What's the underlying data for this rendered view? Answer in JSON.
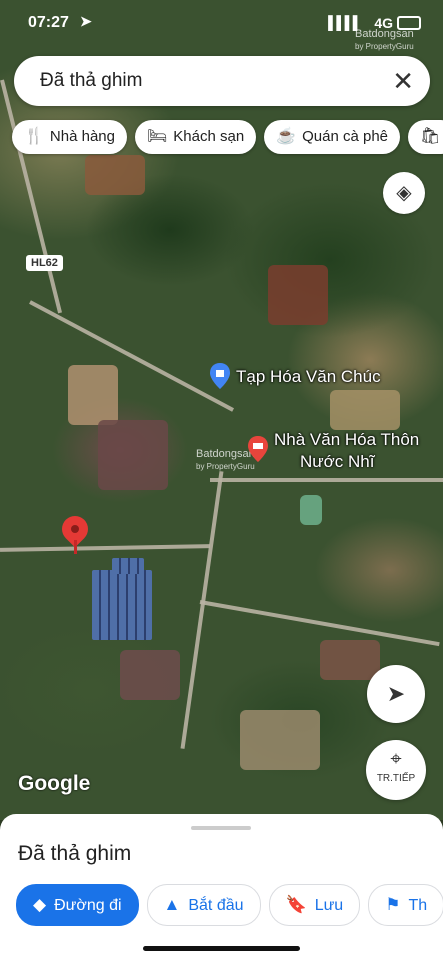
{
  "status": {
    "time": "07:27",
    "network": "4G",
    "signal": "▌▌▌▌"
  },
  "watermarks": [
    "Batdongsan",
    "by PropertyGuru",
    "Batdongsan",
    "by PropertyGuru"
  ],
  "search": {
    "value": "Đã thả ghim"
  },
  "chips": [
    {
      "icon": "🍴",
      "label": "Nhà hàng"
    },
    {
      "icon": "🛏",
      "label": "Khách sạn"
    },
    {
      "icon": "☕",
      "label": "Quán cà phê"
    },
    {
      "icon": "🛍",
      "label": ""
    }
  ],
  "map": {
    "road_label": "HL62",
    "poi1": "Tạp Hóa Văn Chúc",
    "poi2_line1": "Nhà Văn Hóa Thôn",
    "poi2_line2": "Nước Nhĩ",
    "attribution": "Google"
  },
  "controls": {
    "next_label": "TR.TIẾP"
  },
  "sheet": {
    "title": "Đã thả ghim",
    "actions": [
      {
        "icon": "◆",
        "label": "Đường đi"
      },
      {
        "icon": "▲",
        "label": "Bắt đầu"
      },
      {
        "icon": "🔖",
        "label": "Lưu"
      },
      {
        "icon": "⚑",
        "label": "Th"
      }
    ]
  }
}
